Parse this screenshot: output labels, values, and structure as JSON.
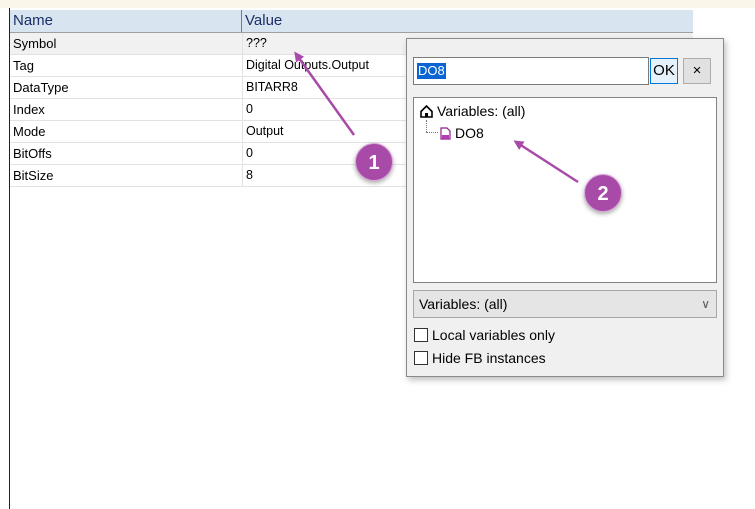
{
  "grid": {
    "header": {
      "name": "Name",
      "value": "Value"
    },
    "rows": [
      {
        "name": "Symbol",
        "value": "???"
      },
      {
        "name": "Tag",
        "value": "Digital Outputs.Output"
      },
      {
        "name": "DataType",
        "value": "BITARR8"
      },
      {
        "name": "Index",
        "value": "0"
      },
      {
        "name": "Mode",
        "value": "Output"
      },
      {
        "name": "BitOffs",
        "value": "0"
      },
      {
        "name": "BitSize",
        "value": "8"
      }
    ]
  },
  "popup": {
    "search_value": "DO8",
    "ok_label": "OK",
    "close_label": "×",
    "tree": {
      "root_label": "Variables: (all)",
      "child_label": "DO8"
    },
    "filter": {
      "selected": "Variables: (all)"
    },
    "checkboxes": {
      "local_only": {
        "label": "Local variables only",
        "checked": false
      },
      "hide_fb": {
        "label": "Hide FB instances",
        "checked": false
      }
    }
  },
  "annotations": {
    "badge1": "1",
    "badge2": "2",
    "color": "#a84aa8"
  }
}
